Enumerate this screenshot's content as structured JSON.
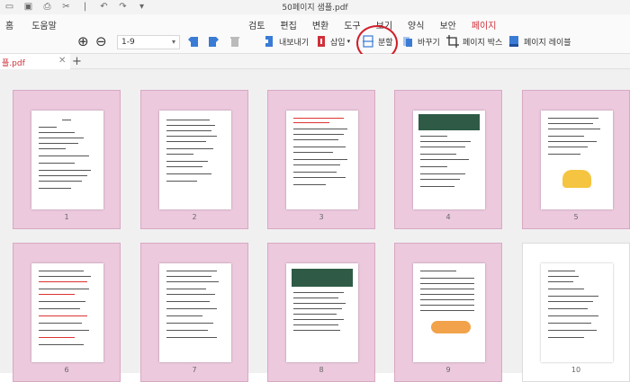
{
  "titlebar": {
    "title": "50페이지 샘플.pdf"
  },
  "menu": {
    "left": [
      "홈",
      "도움말"
    ],
    "tabs": [
      "검토",
      "편집",
      "변환",
      "도구",
      "보기",
      "양식",
      "보안",
      "페이지"
    ],
    "active_tab": "페이지"
  },
  "toolbar": {
    "page_range": "1-9",
    "export": "내보내기",
    "insert": "삽입",
    "split": "분할",
    "replace": "바꾸기",
    "page_box": "페이지 박스",
    "page_label": "페이지 레이블"
  },
  "tabs": {
    "file": "플.pdf"
  },
  "pages": [
    "1",
    "2",
    "3",
    "4",
    "5",
    "6",
    "7",
    "8",
    "9",
    "10"
  ],
  "colors": {
    "accent": "#d0303a",
    "thumb_bg": "#ecc9dd",
    "highlight": "#d01e2a"
  }
}
